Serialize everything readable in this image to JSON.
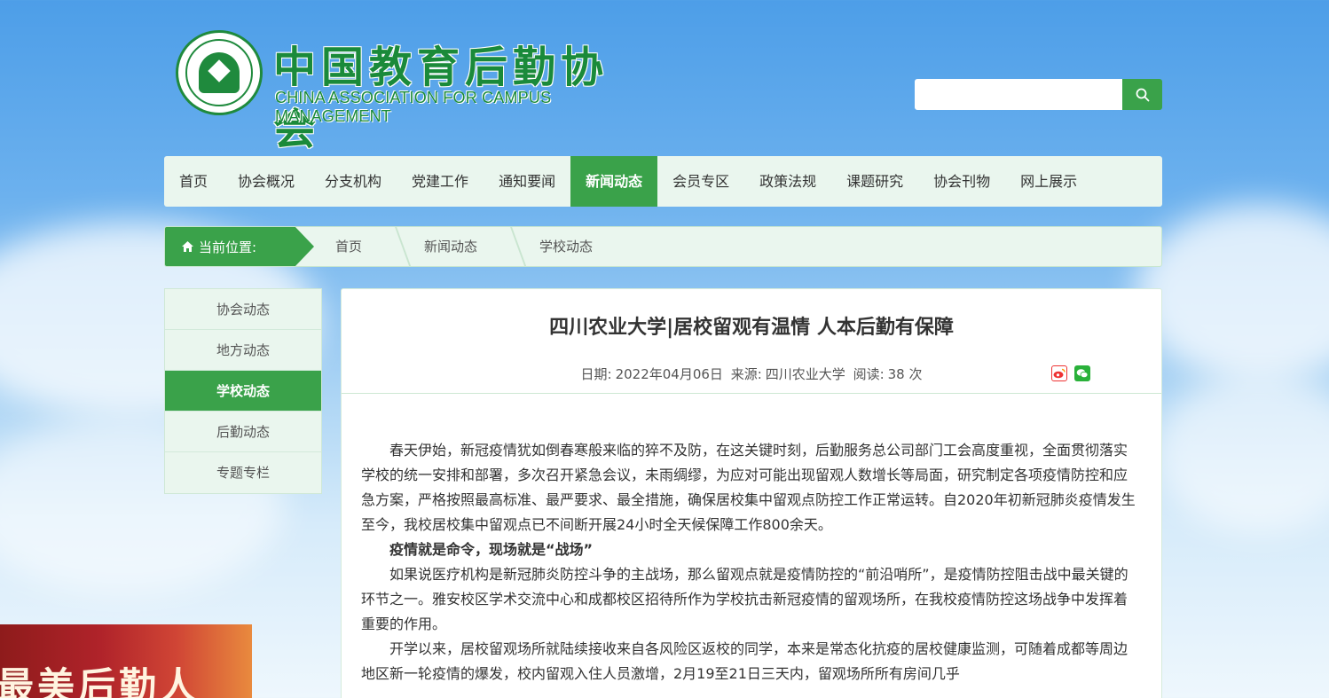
{
  "header": {
    "logo_cn": "中国教育后勤协会",
    "logo_en": "CHINA ASSOCIATION FOR CAMPUS MANAGEMENT",
    "search_placeholder": ""
  },
  "nav": {
    "items": [
      {
        "label": "首页",
        "active": false
      },
      {
        "label": "协会概况",
        "active": false
      },
      {
        "label": "分支机构",
        "active": false
      },
      {
        "label": "党建工作",
        "active": false
      },
      {
        "label": "通知要闻",
        "active": false
      },
      {
        "label": "新闻动态",
        "active": true
      },
      {
        "label": "会员专区",
        "active": false
      },
      {
        "label": "政策法规",
        "active": false
      },
      {
        "label": "课题研究",
        "active": false
      },
      {
        "label": "协会刊物",
        "active": false
      },
      {
        "label": "网上展示",
        "active": false
      }
    ]
  },
  "breadcrumb": {
    "label": "当前位置:",
    "items": [
      "首页",
      "新闻动态",
      "学校动态"
    ]
  },
  "sidebar": {
    "items": [
      {
        "label": "协会动态",
        "active": false
      },
      {
        "label": "地方动态",
        "active": false
      },
      {
        "label": "学校动态",
        "active": true
      },
      {
        "label": "后勤动态",
        "active": false
      },
      {
        "label": "专题专栏",
        "active": false
      }
    ]
  },
  "banner": {
    "text": "最美后勤人"
  },
  "article": {
    "title": "四川农业大学|居校留观有温情 人本后勤有保障",
    "meta": {
      "date_label": "日期:",
      "date": "2022年04月06日",
      "source_label": "来源:",
      "source": "四川农业大学",
      "reads_label": "阅读:",
      "reads": "38 次"
    },
    "paragraphs": [
      {
        "text": "春天伊始，新冠疫情犹如倒春寒般来临的猝不及防，在这关键时刻，后勤服务总公司部门工会高度重视，全面贯彻落实学校的统一安排和部署，多次召开紧急会议，未雨绸缪，为应对可能出现留观人数增长等局面，研究制定各项疫情防控和应急方案，严格按照最高标准、最严要求、最全措施，确保居校集中留观点防控工作正常运转。自2020年初新冠肺炎疫情发生至今，我校居校集中留观点已不间断开展24小时全天候保障工作800余天。",
        "bold": false
      },
      {
        "text": "疫情就是命令，现场就是“战场”",
        "bold": true
      },
      {
        "text": "如果说医疗机构是新冠肺炎防控斗争的主战场，那么留观点就是疫情防控的“前沿哨所”，是疫情防控阻击战中最关键的环节之一。雅安校区学术交流中心和成都校区招待所作为学校抗击新冠疫情的留观场所，在我校疫情防控这场战争中发挥着重要的作用。",
        "bold": false
      },
      {
        "text": "开学以来，居校留观场所就陆续接收来自各风险区返校的同学，本来是常态化抗疫的居校健康监测，可随着成都等周边地区新一轮疫情的爆发，校内留观入住人员激增，2月19至21日三天内，留观场所所有房间几乎",
        "bold": false
      }
    ]
  },
  "colors": {
    "accent": "#3aa24a",
    "panel": "#eaf6ee",
    "brand_text": "#1a8a3a"
  }
}
